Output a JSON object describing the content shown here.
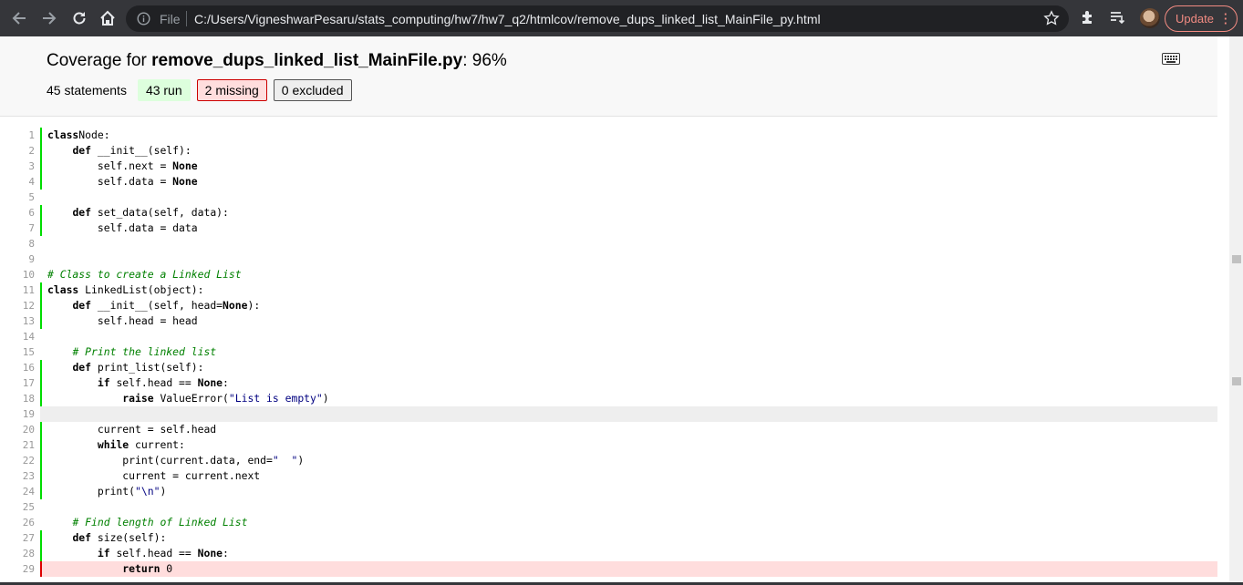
{
  "browser": {
    "file_label": "File",
    "url": "C:/Users/VigneshwarPesaru/stats_computing/hw7/hw7_q2/htmlcov/remove_dups_linked_list_MainFile_py.html",
    "update_label": "Update",
    "icons": [
      "back-icon",
      "forward-icon",
      "reload-icon",
      "home-icon",
      "info-icon",
      "star-icon",
      "extensions-icon",
      "reading-list-icon",
      "profile-avatar",
      "menu-dots-icon"
    ]
  },
  "report": {
    "title_prefix": "Coverage for ",
    "file_name": "remove_dups_linked_list_MainFile.py",
    "percent": ": 96%",
    "statements": "45 statements",
    "run": "43 run",
    "missing": "2 missing",
    "excluded": "0 excluded"
  },
  "colors": {
    "run": "#00dd00",
    "missing": "#dd0000",
    "missing_bg": "#ffdddd",
    "chrome": "#35363a",
    "update": "#f28b82"
  },
  "lines": [
    {
      "n": "1",
      "s": "run",
      "t": [
        [
          "kw",
          "class"
        ],
        [
          "",
          "Node:"
        ]
      ]
    },
    {
      "n": "2",
      "s": "run",
      "t": [
        [
          "",
          "    "
        ],
        [
          "kw",
          "def"
        ],
        [
          "",
          " __init__(self):"
        ]
      ]
    },
    {
      "n": "3",
      "s": "run",
      "t": [
        [
          "",
          "        self.next = "
        ],
        [
          "kw",
          "None"
        ]
      ]
    },
    {
      "n": "4",
      "s": "run",
      "t": [
        [
          "",
          "        self.data = "
        ],
        [
          "kw",
          "None"
        ]
      ]
    },
    {
      "n": "5",
      "s": "",
      "t": []
    },
    {
      "n": "6",
      "s": "run",
      "t": [
        [
          "",
          "    "
        ],
        [
          "kw",
          "def"
        ],
        [
          "",
          " set_data(self, data):"
        ]
      ]
    },
    {
      "n": "7",
      "s": "run",
      "t": [
        [
          "",
          "        self.data = data"
        ]
      ]
    },
    {
      "n": "8",
      "s": "",
      "t": []
    },
    {
      "n": "9",
      "s": "",
      "t": []
    },
    {
      "n": "10",
      "s": "",
      "t": [
        [
          "com",
          "# Class to create a Linked List"
        ]
      ]
    },
    {
      "n": "11",
      "s": "run",
      "t": [
        [
          "kw",
          "class"
        ],
        [
          "",
          " LinkedList(object):"
        ]
      ]
    },
    {
      "n": "12",
      "s": "run",
      "t": [
        [
          "",
          "    "
        ],
        [
          "kw",
          "def"
        ],
        [
          "",
          " __init__(self, head="
        ],
        [
          "kw",
          "None"
        ],
        [
          "",
          "):"
        ]
      ]
    },
    {
      "n": "13",
      "s": "run",
      "t": [
        [
          "",
          "        self.head = head"
        ]
      ]
    },
    {
      "n": "14",
      "s": "",
      "t": []
    },
    {
      "n": "15",
      "s": "",
      "t": [
        [
          "",
          "    "
        ],
        [
          "com",
          "# Print the linked list"
        ]
      ]
    },
    {
      "n": "16",
      "s": "run",
      "t": [
        [
          "",
          "    "
        ],
        [
          "kw",
          "def"
        ],
        [
          "",
          " print_list(self):"
        ]
      ]
    },
    {
      "n": "17",
      "s": "run",
      "t": [
        [
          "",
          "        "
        ],
        [
          "kw",
          "if"
        ],
        [
          "",
          " self.head == "
        ],
        [
          "kw",
          "None"
        ],
        [
          "",
          ":"
        ]
      ]
    },
    {
      "n": "18",
      "s": "run",
      "t": [
        [
          "",
          "            "
        ],
        [
          "kw",
          "raise"
        ],
        [
          "",
          " ValueError("
        ],
        [
          "str",
          "\"List is empty\""
        ],
        [
          "",
          ")"
        ]
      ]
    },
    {
      "n": "19",
      "s": "hl",
      "t": []
    },
    {
      "n": "20",
      "s": "run",
      "t": [
        [
          "",
          "        current = self.head"
        ]
      ]
    },
    {
      "n": "21",
      "s": "run",
      "t": [
        [
          "",
          "        "
        ],
        [
          "kw",
          "while"
        ],
        [
          "",
          " current:"
        ]
      ]
    },
    {
      "n": "22",
      "s": "run",
      "t": [
        [
          "",
          "            print(current.data, end="
        ],
        [
          "str",
          "\"  \""
        ],
        [
          "",
          ")"
        ]
      ]
    },
    {
      "n": "23",
      "s": "run",
      "t": [
        [
          "",
          "            current = current.next"
        ]
      ]
    },
    {
      "n": "24",
      "s": "run",
      "t": [
        [
          "",
          "        print("
        ],
        [
          "str",
          "\"\\n\""
        ],
        [
          "",
          ")"
        ]
      ]
    },
    {
      "n": "25",
      "s": "",
      "t": []
    },
    {
      "n": "26",
      "s": "",
      "t": [
        [
          "",
          "    "
        ],
        [
          "com",
          "# Find length of Linked List"
        ]
      ]
    },
    {
      "n": "27",
      "s": "run",
      "t": [
        [
          "",
          "    "
        ],
        [
          "kw",
          "def"
        ],
        [
          "",
          " size(self):"
        ]
      ]
    },
    {
      "n": "28",
      "s": "run",
      "t": [
        [
          "",
          "        "
        ],
        [
          "kw",
          "if"
        ],
        [
          "",
          " self.head == "
        ],
        [
          "kw",
          "None"
        ],
        [
          "",
          ":"
        ]
      ]
    },
    {
      "n": "29",
      "s": "mis",
      "t": [
        [
          "",
          "            "
        ],
        [
          "kw",
          "return"
        ],
        [
          "",
          " 0"
        ]
      ]
    }
  ]
}
